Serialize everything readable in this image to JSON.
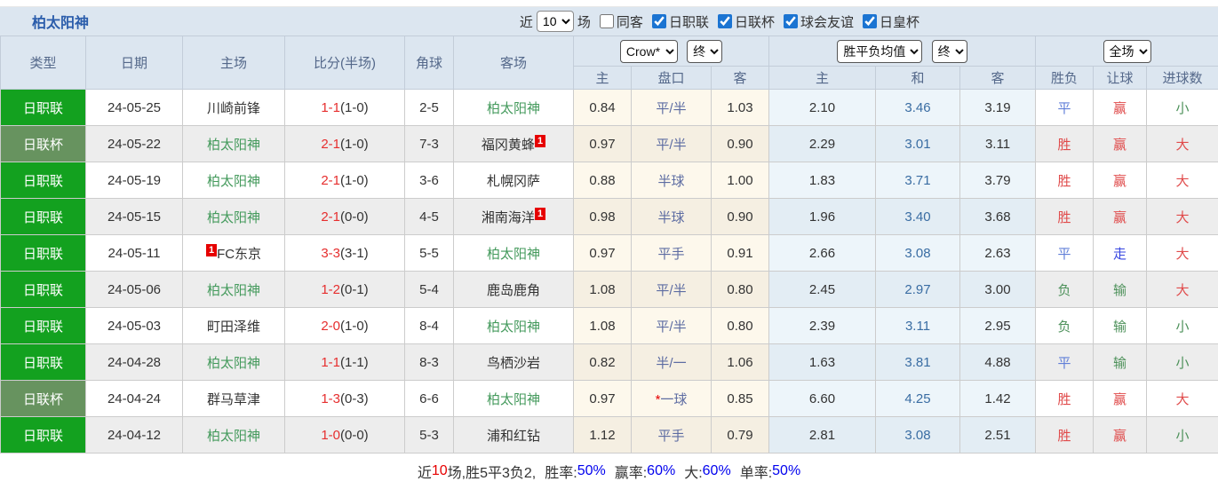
{
  "title": "柏太阳神",
  "controls": {
    "near_label": "近",
    "matches_value": "10",
    "field_label": "场",
    "same_away": {
      "label": "同客",
      "checked": false
    },
    "leagues": [
      {
        "label": "日职联",
        "checked": true
      },
      {
        "label": "日联杯",
        "checked": true
      },
      {
        "label": "球会友谊",
        "checked": true
      },
      {
        "label": "日皇杯",
        "checked": true
      }
    ]
  },
  "selectors": {
    "odds_company": "Crow*",
    "odds_state": "终",
    "avg_name": "胜平负均值",
    "avg_state": "终",
    "result_scope": "全场"
  },
  "headers": {
    "type": "类型",
    "date": "日期",
    "home": "主场",
    "score": "比分(半场)",
    "corners": "角球",
    "away": "客场",
    "odds_home": "主",
    "odds_handicap": "盘口",
    "odds_away": "客",
    "avg_home": "主",
    "avg_draw": "和",
    "avg_away": "客",
    "outcome": "胜负",
    "handicap_result": "让球",
    "goals": "进球数"
  },
  "colors": {
    "league_green": "#13a11f",
    "cup_green": "#67935f",
    "team_green": "#449a5c",
    "score_red": "#e62e2e",
    "handicap_blue": "#5d6ca2",
    "draw_blue": "#3a6da3",
    "result_red": "#e04b4b",
    "result_blue": "#617fd8",
    "result_strong_blue": "#3746e0",
    "result_green": "#4d915a",
    "badge_red": "#e60000",
    "accent_blue": "#1b74d2"
  },
  "table": {
    "rows": [
      {
        "type": "日职联",
        "type_class": "j1",
        "date": "24-05-25",
        "home": {
          "name": "川崎前锋",
          "green": false,
          "badge": "",
          "badge_side": "right"
        },
        "score": {
          "full": "1-1",
          "half": "(1-0)"
        },
        "corners": "2-5",
        "away": {
          "name": "柏太阳神",
          "green": true,
          "badge": "",
          "badge_side": "right"
        },
        "odds": {
          "home": "0.84",
          "handicap": "平/半",
          "star": false,
          "away": "1.03"
        },
        "avg": {
          "home": "2.10",
          "draw": "3.46",
          "away": "3.19"
        },
        "results": {
          "outcome": {
            "text": "平",
            "color": "blue"
          },
          "handicap": {
            "text": "赢",
            "color": "red"
          },
          "goals": {
            "text": "小",
            "color": "green"
          }
        }
      },
      {
        "type": "日联杯",
        "type_class": "cup",
        "date": "24-05-22",
        "home": {
          "name": "柏太阳神",
          "green": true,
          "badge": "",
          "badge_side": "right"
        },
        "score": {
          "full": "2-1",
          "half": "(1-0)"
        },
        "corners": "7-3",
        "away": {
          "name": "福冈黄蜂",
          "green": false,
          "badge": "1",
          "badge_side": "right"
        },
        "odds": {
          "home": "0.97",
          "handicap": "平/半",
          "star": false,
          "away": "0.90"
        },
        "avg": {
          "home": "2.29",
          "draw": "3.01",
          "away": "3.11"
        },
        "results": {
          "outcome": {
            "text": "胜",
            "color": "red"
          },
          "handicap": {
            "text": "赢",
            "color": "red"
          },
          "goals": {
            "text": "大",
            "color": "red"
          }
        }
      },
      {
        "type": "日职联",
        "type_class": "j1",
        "date": "24-05-19",
        "home": {
          "name": "柏太阳神",
          "green": true,
          "badge": "",
          "badge_side": "right"
        },
        "score": {
          "full": "2-1",
          "half": "(1-0)"
        },
        "corners": "3-6",
        "away": {
          "name": "札幌冈萨",
          "green": false,
          "badge": "",
          "badge_side": "right"
        },
        "odds": {
          "home": "0.88",
          "handicap": "半球",
          "star": false,
          "away": "1.00"
        },
        "avg": {
          "home": "1.83",
          "draw": "3.71",
          "away": "3.79"
        },
        "results": {
          "outcome": {
            "text": "胜",
            "color": "red"
          },
          "handicap": {
            "text": "赢",
            "color": "red"
          },
          "goals": {
            "text": "大",
            "color": "red"
          }
        }
      },
      {
        "type": "日职联",
        "type_class": "j1",
        "date": "24-05-15",
        "home": {
          "name": "柏太阳神",
          "green": true,
          "badge": "",
          "badge_side": "right"
        },
        "score": {
          "full": "2-1",
          "half": "(0-0)"
        },
        "corners": "4-5",
        "away": {
          "name": "湘南海洋",
          "green": false,
          "badge": "1",
          "badge_side": "right"
        },
        "odds": {
          "home": "0.98",
          "handicap": "半球",
          "star": false,
          "away": "0.90"
        },
        "avg": {
          "home": "1.96",
          "draw": "3.40",
          "away": "3.68"
        },
        "results": {
          "outcome": {
            "text": "胜",
            "color": "red"
          },
          "handicap": {
            "text": "赢",
            "color": "red"
          },
          "goals": {
            "text": "大",
            "color": "red"
          }
        }
      },
      {
        "type": "日职联",
        "type_class": "j1",
        "date": "24-05-11",
        "home": {
          "name": "FC东京",
          "green": false,
          "badge": "1",
          "badge_side": "left"
        },
        "score": {
          "full": "3-3",
          "half": "(3-1)"
        },
        "corners": "5-5",
        "away": {
          "name": "柏太阳神",
          "green": true,
          "badge": "",
          "badge_side": "right"
        },
        "odds": {
          "home": "0.97",
          "handicap": "平手",
          "star": false,
          "away": "0.91"
        },
        "avg": {
          "home": "2.66",
          "draw": "3.08",
          "away": "2.63"
        },
        "results": {
          "outcome": {
            "text": "平",
            "color": "blue"
          },
          "handicap": {
            "text": "走",
            "color": "blue2"
          },
          "goals": {
            "text": "大",
            "color": "red"
          }
        }
      },
      {
        "type": "日职联",
        "type_class": "j1",
        "date": "24-05-06",
        "home": {
          "name": "柏太阳神",
          "green": true,
          "badge": "",
          "badge_side": "right"
        },
        "score": {
          "full": "1-2",
          "half": "(0-1)"
        },
        "corners": "5-4",
        "away": {
          "name": "鹿岛鹿角",
          "green": false,
          "badge": "",
          "badge_side": "right"
        },
        "odds": {
          "home": "1.08",
          "handicap": "平/半",
          "star": false,
          "away": "0.80"
        },
        "avg": {
          "home": "2.45",
          "draw": "2.97",
          "away": "3.00"
        },
        "results": {
          "outcome": {
            "text": "负",
            "color": "green"
          },
          "handicap": {
            "text": "输",
            "color": "green"
          },
          "goals": {
            "text": "大",
            "color": "red"
          }
        }
      },
      {
        "type": "日职联",
        "type_class": "j1",
        "date": "24-05-03",
        "home": {
          "name": "町田泽维",
          "green": false,
          "badge": "",
          "badge_side": "right"
        },
        "score": {
          "full": "2-0",
          "half": "(1-0)"
        },
        "corners": "8-4",
        "away": {
          "name": "柏太阳神",
          "green": true,
          "badge": "",
          "badge_side": "right"
        },
        "odds": {
          "home": "1.08",
          "handicap": "平/半",
          "star": false,
          "away": "0.80"
        },
        "avg": {
          "home": "2.39",
          "draw": "3.11",
          "away": "2.95"
        },
        "results": {
          "outcome": {
            "text": "负",
            "color": "green"
          },
          "handicap": {
            "text": "输",
            "color": "green"
          },
          "goals": {
            "text": "小",
            "color": "green"
          }
        }
      },
      {
        "type": "日职联",
        "type_class": "j1",
        "date": "24-04-28",
        "home": {
          "name": "柏太阳神",
          "green": true,
          "badge": "",
          "badge_side": "right"
        },
        "score": {
          "full": "1-1",
          "half": "(1-1)"
        },
        "corners": "8-3",
        "away": {
          "name": "鸟栖沙岩",
          "green": false,
          "badge": "",
          "badge_side": "right"
        },
        "odds": {
          "home": "0.82",
          "handicap": "半/一",
          "star": false,
          "away": "1.06"
        },
        "avg": {
          "home": "1.63",
          "draw": "3.81",
          "away": "4.88"
        },
        "results": {
          "outcome": {
            "text": "平",
            "color": "blue"
          },
          "handicap": {
            "text": "输",
            "color": "green"
          },
          "goals": {
            "text": "小",
            "color": "green"
          }
        }
      },
      {
        "type": "日联杯",
        "type_class": "cup",
        "date": "24-04-24",
        "home": {
          "name": "群马草津",
          "green": false,
          "badge": "",
          "badge_side": "right"
        },
        "score": {
          "full": "1-3",
          "half": "(0-3)"
        },
        "corners": "6-6",
        "away": {
          "name": "柏太阳神",
          "green": true,
          "badge": "",
          "badge_side": "right"
        },
        "odds": {
          "home": "0.97",
          "handicap": "一球",
          "star": true,
          "away": "0.85"
        },
        "avg": {
          "home": "6.60",
          "draw": "4.25",
          "away": "1.42"
        },
        "results": {
          "outcome": {
            "text": "胜",
            "color": "red"
          },
          "handicap": {
            "text": "赢",
            "color": "red"
          },
          "goals": {
            "text": "大",
            "color": "red"
          }
        }
      },
      {
        "type": "日职联",
        "type_class": "j1",
        "date": "24-04-12",
        "home": {
          "name": "柏太阳神",
          "green": true,
          "badge": "",
          "badge_side": "right"
        },
        "score": {
          "full": "1-0",
          "half": "(0-0)"
        },
        "corners": "5-3",
        "away": {
          "name": "浦和红钻",
          "green": false,
          "badge": "",
          "badge_side": "right"
        },
        "odds": {
          "home": "1.12",
          "handicap": "平手",
          "star": false,
          "away": "0.79"
        },
        "avg": {
          "home": "2.81",
          "draw": "3.08",
          "away": "2.51"
        },
        "results": {
          "outcome": {
            "text": "胜",
            "color": "red"
          },
          "handicap": {
            "text": "赢",
            "color": "red"
          },
          "goals": {
            "text": "小",
            "color": "green"
          }
        }
      }
    ]
  },
  "footer": {
    "near_label": "近",
    "match_count": "10",
    "summary": "场,胜5平3负2,",
    "win_rate_label": "胜率:",
    "win_rate": "50%",
    "handicap_rate_label": "赢率:",
    "handicap_rate": "60%",
    "big_rate_label": "大:",
    "big_rate": "60%",
    "single_rate_label": "单率:",
    "single_rate": "50%"
  }
}
